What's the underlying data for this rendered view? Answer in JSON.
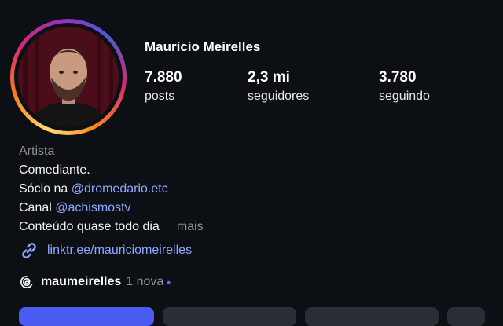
{
  "profile": {
    "name": "Maurício Meirelles",
    "stats": {
      "posts": {
        "value": "7.880",
        "label": "posts"
      },
      "followers": {
        "value": "2,3 mi",
        "label": "seguidores"
      },
      "following": {
        "value": "3.780",
        "label": "seguindo"
      }
    }
  },
  "bio": {
    "category": "Artista",
    "line1": "Comediante.",
    "line2_prefix": "Sócio na ",
    "line2_mention": "@dromedario.etc",
    "line3_prefix": "Canal ",
    "line3_mention": "@achismostv",
    "line4": "Conteúdo quase todo dia",
    "more": "mais"
  },
  "link": {
    "text": "linktr.ee/mauriciomeirelles",
    "icon": "link-icon"
  },
  "threads": {
    "icon": "threads-icon",
    "handle": "maumeirelles",
    "new_label": "1 nova",
    "dot": "•"
  },
  "colors": {
    "background": "#0c0f14",
    "mention": "#8fa8ff",
    "primary_button": "#4a5cf0",
    "secondary_button": "#2a2d33"
  }
}
